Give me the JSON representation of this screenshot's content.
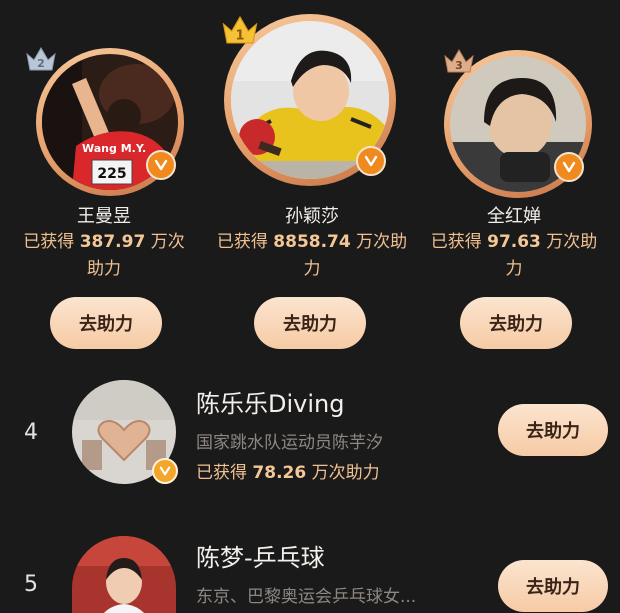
{
  "podium": [
    {
      "rank_badge": "2",
      "name": "王曼昱",
      "votes_prefix": "已获得",
      "votes_value": "387.97",
      "votes_unit_line1": "万次",
      "votes_line2": "助力",
      "button": "去助力",
      "photo_text": "Wang M.Y.",
      "photo_number": "225"
    },
    {
      "rank_badge": "1",
      "name": "孙颖莎",
      "votes_prefix": "已获得",
      "votes_value": "8858.74",
      "votes_unit_line1": "万次助",
      "votes_line2": "力",
      "button": "去助力"
    },
    {
      "rank_badge": "3",
      "name": "全红婵",
      "votes_prefix": "已获得",
      "votes_value": "97.63",
      "votes_unit_line1": "万次助",
      "votes_line2": "力",
      "button": "去助力"
    }
  ],
  "list": [
    {
      "rank": "4",
      "title": "陈乐乐Diving",
      "desc": "国家跳水队运动员陈芋汐",
      "votes_prefix": "已获得",
      "votes_value": "78.26",
      "votes_suffix": "万次助力",
      "button": "去助力"
    },
    {
      "rank": "5",
      "title": "陈梦-乒乓球",
      "desc": "东京、巴黎奥运会乒乓球女...",
      "button": "去助力"
    }
  ],
  "colors": {
    "accent": "#f0c090",
    "button_bg": "#f6cba5",
    "badge": "#f08a1f",
    "background": "#1b1a1a"
  },
  "icons": [
    "crown-icon",
    "verified-icon"
  ]
}
